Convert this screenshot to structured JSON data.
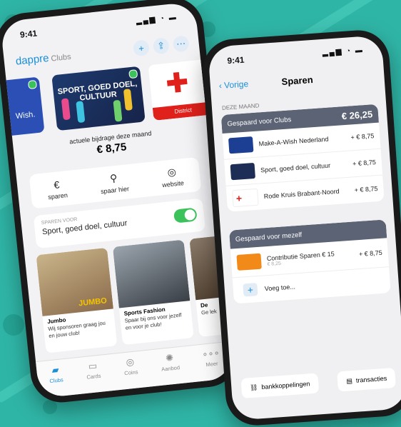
{
  "theme": {
    "accent": "#1a8fd8",
    "background": "#2fb5a6",
    "success": "#3cc25a",
    "header_dark": "#5b6375"
  },
  "left_phone": {
    "time": "9:41",
    "brand": "dappre",
    "brand_sub": "Clubs",
    "header_icons": [
      "plus-icon",
      "share-icon",
      "more-icon"
    ],
    "cards": [
      {
        "label": "Wish.",
        "checked": true
      },
      {
        "title": "SPORT, GOED DOEL, CULTUUR",
        "checked": true
      },
      {
        "label": "District"
      }
    ],
    "contribution_label": "actuele bijdrage deze maand",
    "contribution_amount": "€ 8,75",
    "actions": [
      {
        "label": "sparen",
        "icon": "euro-icon"
      },
      {
        "label": "spaar hier",
        "icon": "location-pin-icon"
      },
      {
        "label": "website",
        "icon": "compass-icon"
      }
    ],
    "sparen_voor": {
      "label": "SPAREN VOOR",
      "value": "Sport, goed doel, cultuur",
      "enabled": true
    },
    "sponsors": [
      {
        "name": "Jumbo",
        "desc": "Wij sponsoren graag jou en jouw club!",
        "img_label": "JUMBO"
      },
      {
        "name": "Sports Fashion",
        "desc": "Spaar bij ons voor jezelf en voor je club!"
      },
      {
        "name": "De",
        "desc": "Ge lek"
      }
    ],
    "tabs": [
      {
        "label": "Clubs",
        "icon": "clubs-icon",
        "active": true
      },
      {
        "label": "Cards",
        "icon": "card-icon"
      },
      {
        "label": "Coins",
        "icon": "coin-icon"
      },
      {
        "label": "Aanbod",
        "icon": "offer-icon"
      },
      {
        "label": "Meer",
        "icon": "more-icon"
      }
    ]
  },
  "right_phone": {
    "time": "9:41",
    "back_label": "Vorige",
    "title": "Sparen",
    "section": "DEZE MAAND",
    "clubs_group": {
      "title": "Gespaard voor Clubs",
      "total": "€ 26,25",
      "rows": [
        {
          "name": "Make-A-Wish Nederland",
          "amount": "+ € 8,75"
        },
        {
          "name": "Sport, goed doel, cultuur",
          "amount": "+ € 8,75"
        },
        {
          "name": "Rode Kruis Brabant-Noord",
          "amount": "+ € 8,75"
        }
      ]
    },
    "self_group": {
      "title": "Gespaard voor mezelf",
      "rows": [
        {
          "name": "Contributie Sparen € 15",
          "sub": "€ 8,25",
          "amount": "+ € 8,75"
        }
      ],
      "add_label": "Voeg toe..."
    },
    "buttons": [
      {
        "label": "bankkoppelingen",
        "icon": "link-icon"
      },
      {
        "label": "transacties",
        "icon": "receipt-icon"
      }
    ]
  }
}
